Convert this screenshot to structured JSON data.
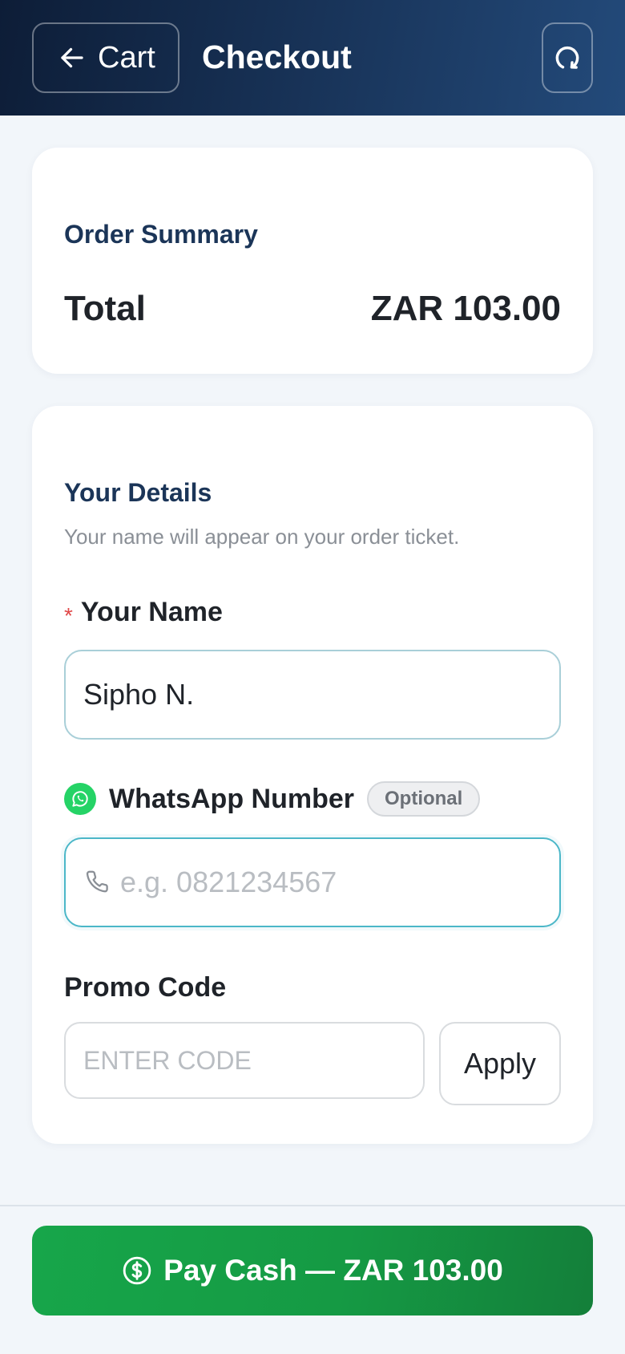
{
  "header": {
    "back_label": "Cart",
    "title": "Checkout",
    "back_icon": "arrow-left-icon",
    "refresh_icon": "refresh-icon"
  },
  "order_summary": {
    "title": "Order Summary",
    "total_label": "Total",
    "total_value": "ZAR 103.00"
  },
  "details": {
    "title": "Your Details",
    "subtitle": "Your name will appear on your order ticket.",
    "name": {
      "required_mark": "*",
      "label": "Your Name",
      "value": "Sipho N."
    },
    "whatsapp": {
      "icon": "whatsapp-icon",
      "label": "WhatsApp Number",
      "badge": "Optional",
      "placeholder": "e.g. 0821234567",
      "value": "",
      "input_icon": "phone-icon"
    },
    "promo": {
      "label": "Promo Code",
      "placeholder": "ENTER CODE",
      "value": "",
      "apply_label": "Apply"
    }
  },
  "footer": {
    "pay_label": "Pay Cash — ZAR 103.00",
    "pay_icon": "dollar-circle-icon"
  },
  "colors": {
    "header_start": "#0d1d37",
    "header_end": "#234a7a",
    "section_title": "#1b3558",
    "pay_button": "#17a64a",
    "whatsapp_green": "#25d366",
    "required_red": "#e04848",
    "focus_border": "#4bb7c8"
  }
}
